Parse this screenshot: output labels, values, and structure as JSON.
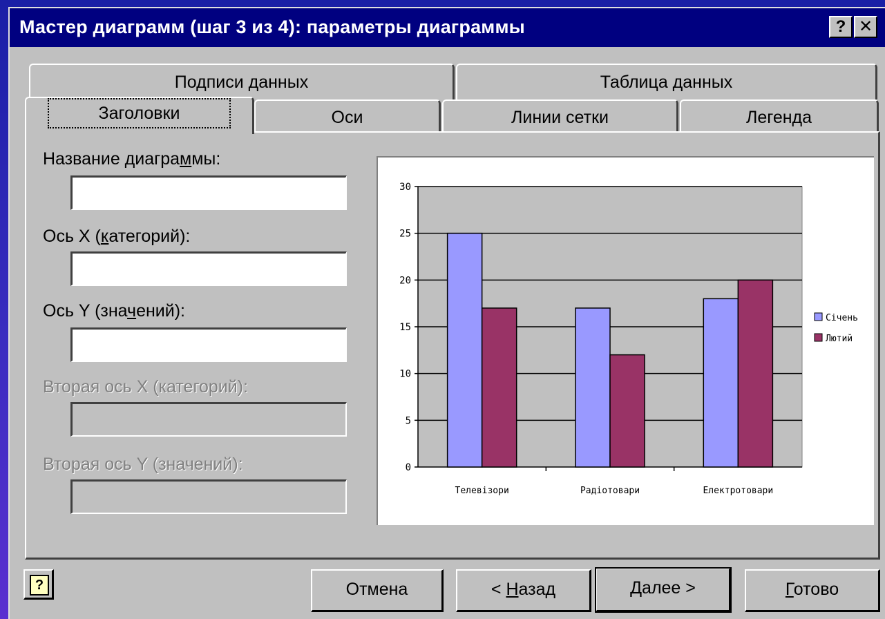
{
  "window": {
    "title": "Мастер диаграмм (шаг 3 из 4): параметры диаграммы",
    "help_button": "?",
    "close_button": "✕"
  },
  "tabs_back": [
    "Подписи данных",
    "Таблица данных"
  ],
  "tabs_front": [
    "Заголовки",
    "Оси",
    "Линии сетки",
    "Легенда"
  ],
  "active_tab": "Заголовки",
  "fields": {
    "chart_title": {
      "label_pre": "Название диагра",
      "label_u": "м",
      "label_post": "мы:",
      "value": ""
    },
    "x_axis": {
      "label_pre": "Ось X (",
      "label_u": "к",
      "label_post": "атегорий):",
      "value": ""
    },
    "y_axis": {
      "label_pre": "Ось Y (зна",
      "label_u": "ч",
      "label_post": "ений):",
      "value": ""
    },
    "x2_axis": {
      "label": "Вторая ось X (категорий):",
      "value": ""
    },
    "y2_axis": {
      "label": "Вторая ось Y (значений):",
      "value": ""
    }
  },
  "buttons": {
    "cancel": "Отмена",
    "back_pre": "< ",
    "back_u": "Н",
    "back_post": "азад",
    "next": "Далее >",
    "finish_u": "Г",
    "finish_post": "отово"
  },
  "chart_data": {
    "type": "bar",
    "categories": [
      "Телевізори",
      "Радіотовари",
      "Електротовари"
    ],
    "series": [
      {
        "name": "Січень",
        "values": [
          25,
          17,
          18
        ],
        "color": "#9999ff"
      },
      {
        "name": "Лютий",
        "values": [
          17,
          12,
          20
        ],
        "color": "#993366"
      }
    ],
    "ylim": [
      0,
      30
    ],
    "yticks": [
      0,
      5,
      10,
      15,
      20,
      25,
      30
    ],
    "grid": true,
    "legend": "right",
    "plot_background": "#c0c0c0"
  }
}
